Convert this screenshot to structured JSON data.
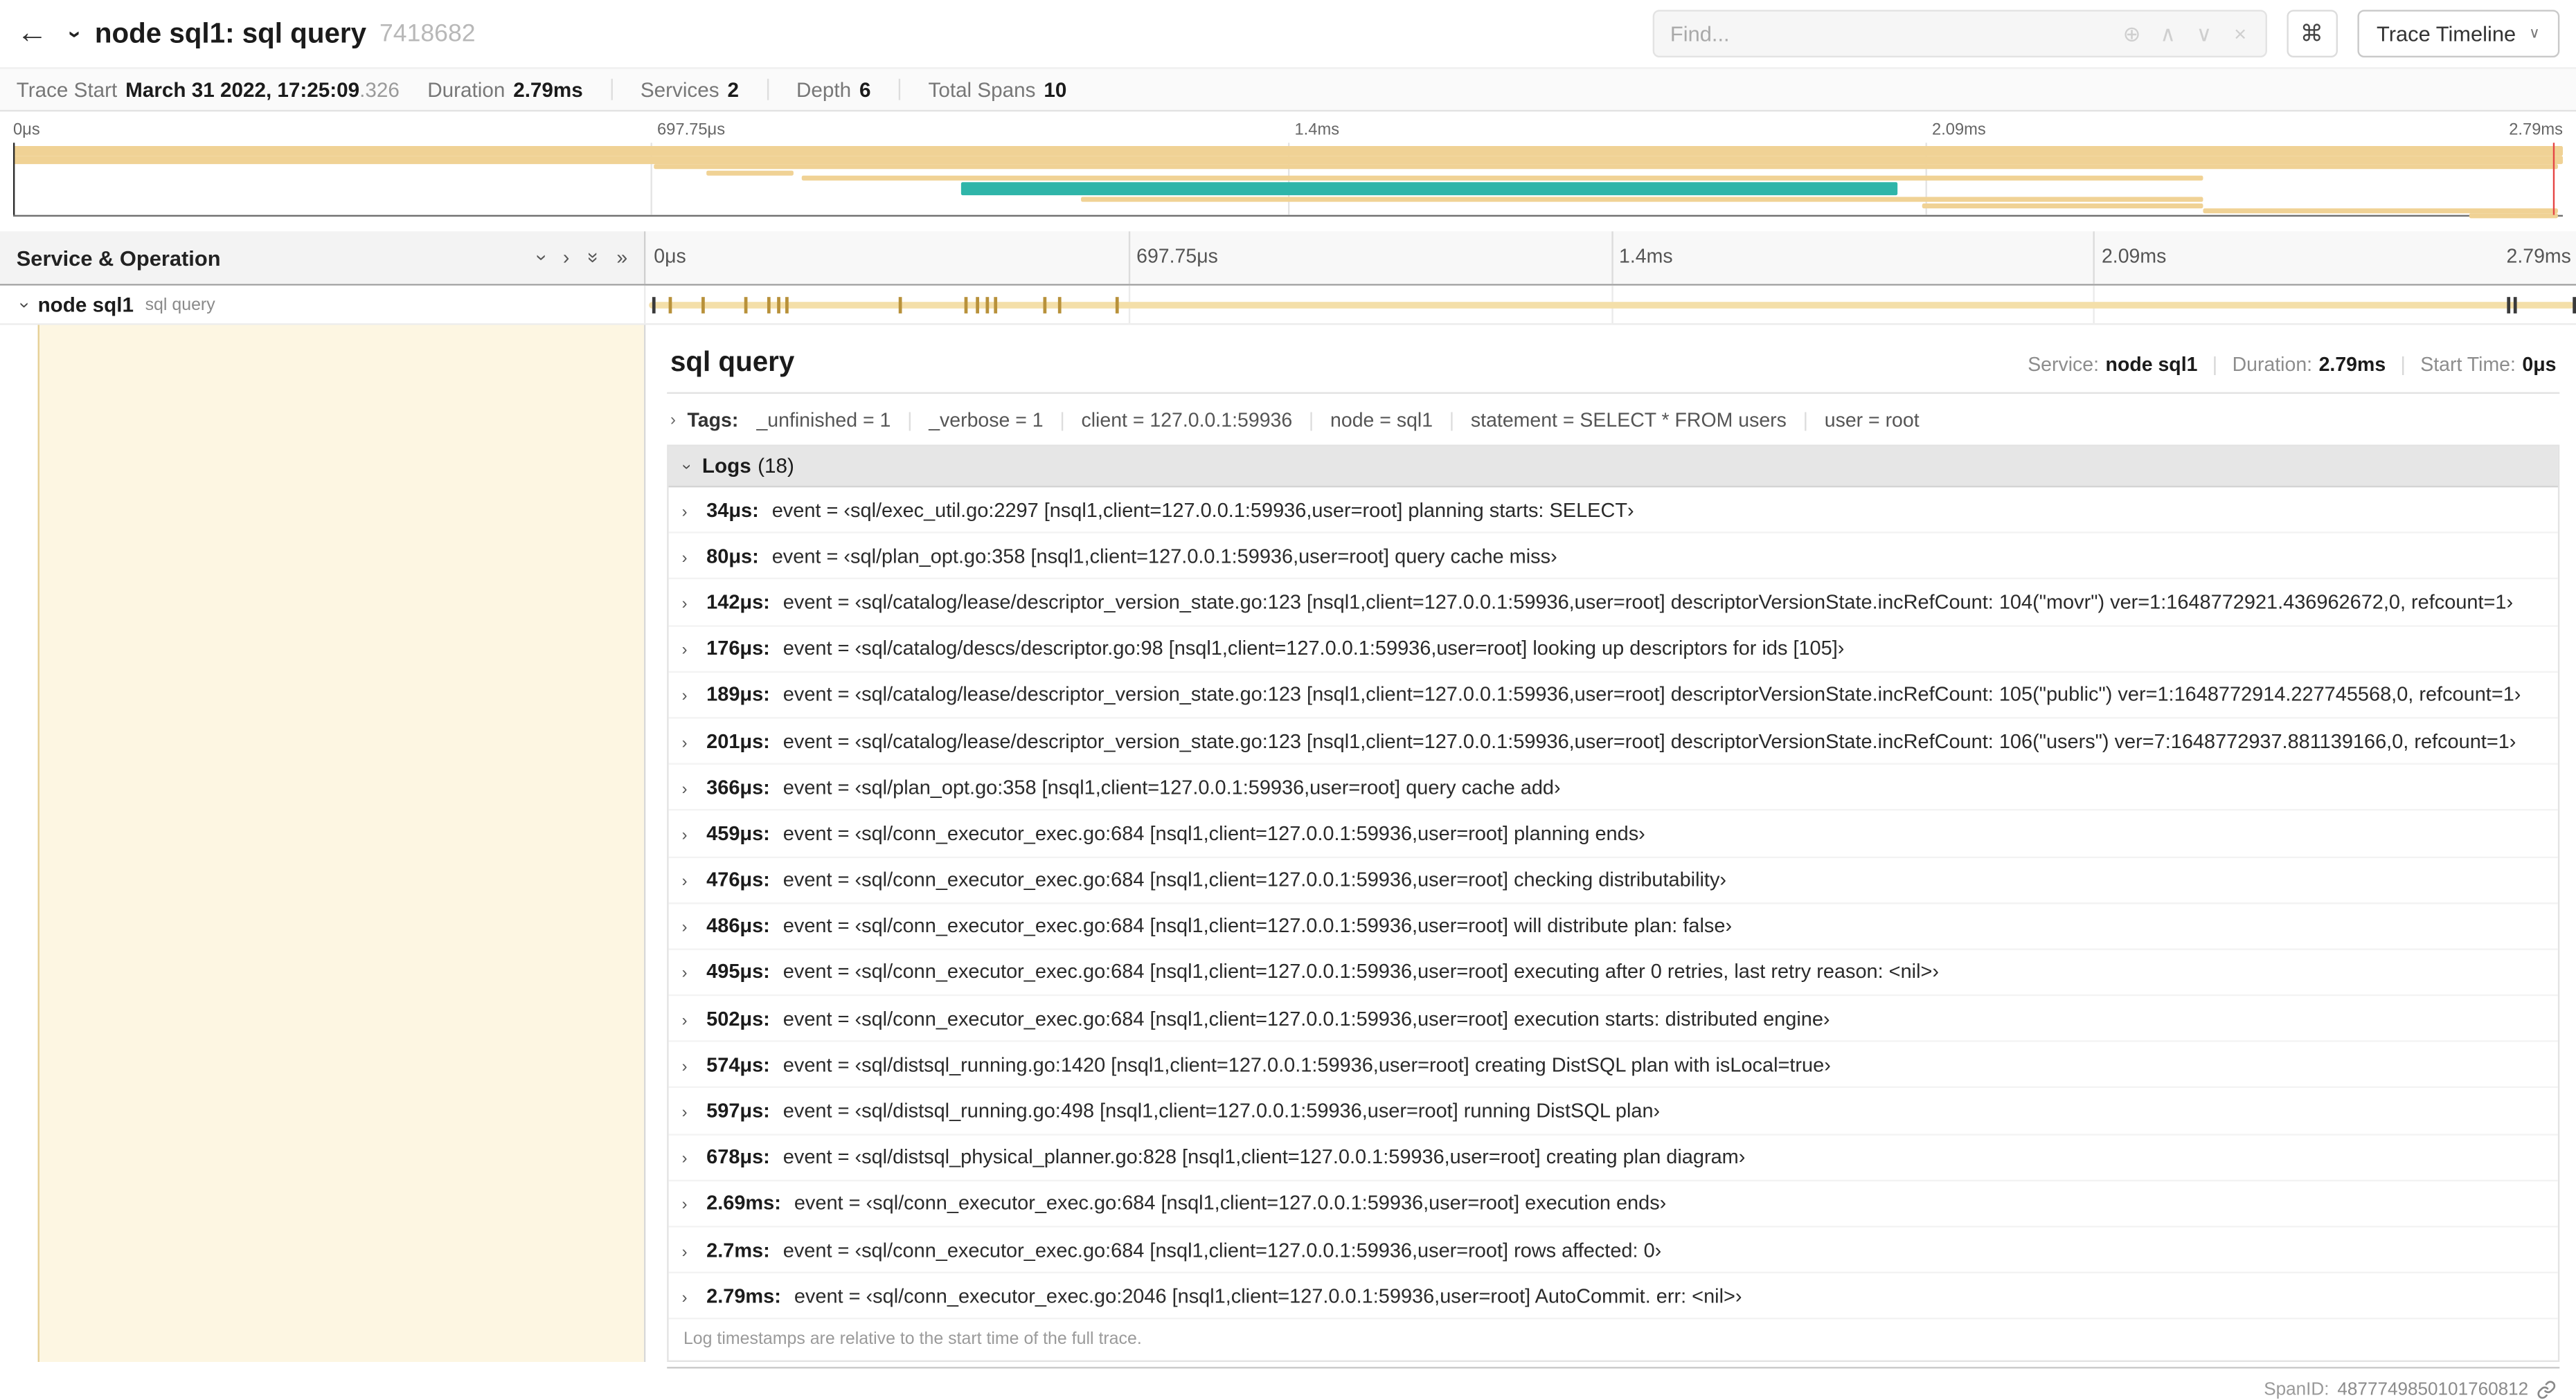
{
  "header": {
    "back_icon": "←",
    "title": "node sql1: sql query",
    "trace_id": "7418682",
    "find_placeholder": "Find...",
    "find_icons": [
      {
        "name": "match-count-icon",
        "glyph": "⊕"
      },
      {
        "name": "prev-result-icon",
        "glyph": "∧"
      },
      {
        "name": "next-result-icon",
        "glyph": "∨"
      },
      {
        "name": "clear-find-icon",
        "glyph": "×"
      }
    ],
    "kbd": "⌘",
    "view_button": "Trace Timeline",
    "view_caret": "∨"
  },
  "summary": {
    "items": [
      {
        "label": "Trace Start",
        "value": "March 31 2022, 17:25:09",
        "suffix": ".326"
      },
      {
        "label": "Duration",
        "value": "2.79ms"
      },
      {
        "label": "Services",
        "value": "2"
      },
      {
        "label": "Depth",
        "value": "6"
      },
      {
        "label": "Total Spans",
        "value": "10"
      }
    ]
  },
  "minimap": {
    "ticks": [
      "0μs",
      "697.75μs",
      "1.4ms",
      "2.09ms",
      "2.79ms"
    ],
    "colors": {
      "tan": "#f0d295",
      "teal": "#2fb5a9"
    },
    "spans": [
      {
        "row": 0,
        "start": 0,
        "end": 100,
        "color": "tan"
      },
      {
        "row": 1,
        "start": 0,
        "end": 100,
        "color": "tan"
      },
      {
        "row": 2,
        "start": 25.1,
        "end": 99.8,
        "color": "tan"
      },
      {
        "row": 3,
        "start": 27.2,
        "end": 30.6,
        "color": "tan"
      },
      {
        "row": 4,
        "start": 30.9,
        "end": 85.9,
        "color": "tan"
      },
      {
        "row": 5,
        "start": 37.2,
        "end": 73.9,
        "color": "teal"
      },
      {
        "row": 6,
        "start": 41.9,
        "end": 85.9,
        "color": "tan"
      },
      {
        "row": 7,
        "start": 74.9,
        "end": 85.9,
        "color": "tan"
      },
      {
        "row": 8,
        "start": 85.9,
        "end": 99.8,
        "color": "tan"
      },
      {
        "row": 9,
        "start": 96.3,
        "end": 99.8,
        "color": "tan"
      }
    ],
    "cursor_pct": 99.6
  },
  "timeline": {
    "left_header": "Service & Operation",
    "collapse_icons": [
      {
        "name": "chevron-down-icon",
        "glyph": "›",
        "rot": true
      },
      {
        "name": "chevron-right-icon",
        "glyph": "›",
        "rot": false
      },
      {
        "name": "double-chevron-down-icon",
        "glyph": "»",
        "rot": true
      },
      {
        "name": "double-chevron-right-icon",
        "glyph": "»",
        "rot": false
      }
    ],
    "ticks": [
      "0μs",
      "697.75μs",
      "1.4ms",
      "2.09ms",
      "2.79ms"
    ],
    "row": {
      "service": "node sql1",
      "operation": "sql query"
    },
    "bar": {
      "start": 0.15,
      "end": 99.9
    },
    "tick_marks": [
      {
        "p": 0.3,
        "dark": true
      },
      {
        "p": 1.2
      },
      {
        "p": 2.9
      },
      {
        "p": 5.1
      },
      {
        "p": 6.3
      },
      {
        "p": 6.8
      },
      {
        "p": 7.2
      },
      {
        "p": 13.1
      },
      {
        "p": 16.5
      },
      {
        "p": 17.1
      },
      {
        "p": 17.6
      },
      {
        "p": 18.0
      },
      {
        "p": 20.6
      },
      {
        "p": 21.4
      },
      {
        "p": 24.3
      },
      {
        "p": 96.4,
        "dark": true
      },
      {
        "p": 96.8,
        "dark": true
      },
      {
        "p": 99.8,
        "dark": true
      }
    ]
  },
  "detail": {
    "title": "sql query",
    "meta": [
      {
        "label": "Service:",
        "value": "node sql1"
      },
      {
        "label": "Duration:",
        "value": "2.79ms"
      },
      {
        "label": "Start Time:",
        "value": "0μs"
      }
    ],
    "tags_label": "Tags:",
    "tags": [
      {
        "key": "_unfinished",
        "value": "1"
      },
      {
        "key": "_verbose",
        "value": "1"
      },
      {
        "key": "client",
        "value": "127.0.0.1:59936"
      },
      {
        "key": "node",
        "value": "sql1"
      },
      {
        "key": "statement",
        "value": "SELECT * FROM users"
      },
      {
        "key": "user",
        "value": "root"
      }
    ],
    "logs_label": "Logs",
    "logs_count": "(18)",
    "logs": [
      {
        "time": "34μs:",
        "text": "event = ‹sql/exec_util.go:2297 [nsql1,client=127.0.0.1:59936,user=root] planning starts: SELECT›"
      },
      {
        "time": "80μs:",
        "text": "event = ‹sql/plan_opt.go:358 [nsql1,client=127.0.0.1:59936,user=root] query cache miss›"
      },
      {
        "time": "142μs:",
        "text": "event = ‹sql/catalog/lease/descriptor_version_state.go:123 [nsql1,client=127.0.0.1:59936,user=root] descriptorVersionState.incRefCount: 104(\"movr\") ver=1:1648772921.436962672,0, refcount=1›"
      },
      {
        "time": "176μs:",
        "text": "event = ‹sql/catalog/descs/descriptor.go:98 [nsql1,client=127.0.0.1:59936,user=root] looking up descriptors for ids [105]›"
      },
      {
        "time": "189μs:",
        "text": "event = ‹sql/catalog/lease/descriptor_version_state.go:123 [nsql1,client=127.0.0.1:59936,user=root] descriptorVersionState.incRefCount: 105(\"public\") ver=1:1648772914.227745568,0, refcount=1›"
      },
      {
        "time": "201μs:",
        "text": "event = ‹sql/catalog/lease/descriptor_version_state.go:123 [nsql1,client=127.0.0.1:59936,user=root] descriptorVersionState.incRefCount: 106(\"users\") ver=7:1648772937.881139166,0, refcount=1›"
      },
      {
        "time": "366μs:",
        "text": "event = ‹sql/plan_opt.go:358 [nsql1,client=127.0.0.1:59936,user=root] query cache add›"
      },
      {
        "time": "459μs:",
        "text": "event = ‹sql/conn_executor_exec.go:684 [nsql1,client=127.0.0.1:59936,user=root] planning ends›"
      },
      {
        "time": "476μs:",
        "text": "event = ‹sql/conn_executor_exec.go:684 [nsql1,client=127.0.0.1:59936,user=root] checking distributability›"
      },
      {
        "time": "486μs:",
        "text": "event = ‹sql/conn_executor_exec.go:684 [nsql1,client=127.0.0.1:59936,user=root] will distribute plan: false›"
      },
      {
        "time": "495μs:",
        "text": "event = ‹sql/conn_executor_exec.go:684 [nsql1,client=127.0.0.1:59936,user=root] executing after 0 retries, last retry reason: <nil>›"
      },
      {
        "time": "502μs:",
        "text": "event = ‹sql/conn_executor_exec.go:684 [nsql1,client=127.0.0.1:59936,user=root] execution starts: distributed engine›"
      },
      {
        "time": "574μs:",
        "text": "event = ‹sql/distsql_running.go:1420 [nsql1,client=127.0.0.1:59936,user=root] creating DistSQL plan with isLocal=true›"
      },
      {
        "time": "597μs:",
        "text": "event = ‹sql/distsql_running.go:498 [nsql1,client=127.0.0.1:59936,user=root] running DistSQL plan›"
      },
      {
        "time": "678μs:",
        "text": "event = ‹sql/distsql_physical_planner.go:828 [nsql1,client=127.0.0.1:59936,user=root] creating plan diagram›"
      },
      {
        "time": "2.69ms:",
        "text": "event = ‹sql/conn_executor_exec.go:684 [nsql1,client=127.0.0.1:59936,user=root] execution ends›"
      },
      {
        "time": "2.7ms:",
        "text": "event = ‹sql/conn_executor_exec.go:684 [nsql1,client=127.0.0.1:59936,user=root] rows affected: 0›"
      },
      {
        "time": "2.79ms:",
        "text": "event = ‹sql/conn_executor_exec.go:2046 [nsql1,client=127.0.0.1:59936,user=root] AutoCommit. err: <nil>›"
      }
    ],
    "footer_note": "Log timestamps are relative to the start time of the full trace.",
    "span_id_label": "SpanID:",
    "span_id": "4877749850101760812"
  }
}
